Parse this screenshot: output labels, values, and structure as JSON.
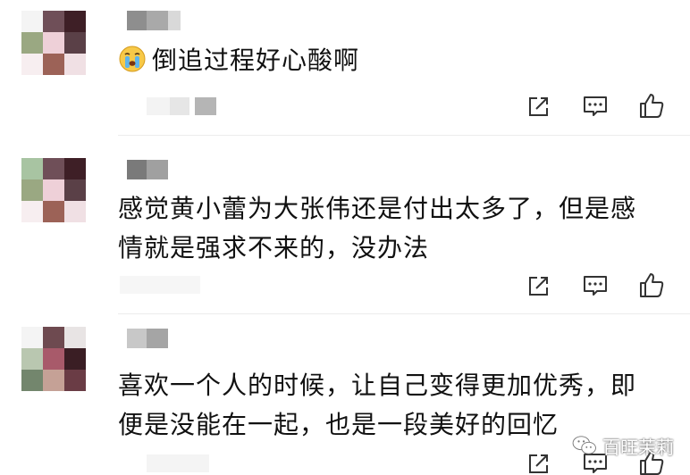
{
  "comments": [
    {
      "text": "倒追过程好心酸啊",
      "emoji": "crying-face-emoji",
      "avatar_colors": [
        "#f4f4f4",
        "#6f4f58",
        "#3e1f26",
        "#9aa882",
        "#eed0d8",
        "#5a4047",
        "#f7eef0",
        "#9c6257",
        "#f0e0e4"
      ]
    },
    {
      "text": "感觉黄小蕾为大张伟还是付出太多了，但是感情就是强求不来的，没办法",
      "avatar_colors": [
        "#a8c4a2",
        "#6f4f58",
        "#3e1f26",
        "#9aa882",
        "#eed0d8",
        "#5a4047",
        "#f7eef0",
        "#9c6257",
        "#f0e0e4"
      ]
    },
    {
      "text": "喜欢一个人的时候，让自己变得更加优秀，即便是没能在一起，也是一段美好的回忆",
      "avatar_colors": [
        "#f4f4f4",
        "#6e4a50",
        "#e8e4e4",
        "#b9c7b0",
        "#a85a6a",
        "#3a1e24",
        "#73866d",
        "#c5a196",
        "#6a3c45"
      ]
    }
  ],
  "actions": {
    "share": "share-icon",
    "reply": "comment-icon",
    "like": "thumbs-up-icon"
  },
  "watermark": {
    "text": "百旺茉莉",
    "icon": "wechat-icon"
  }
}
